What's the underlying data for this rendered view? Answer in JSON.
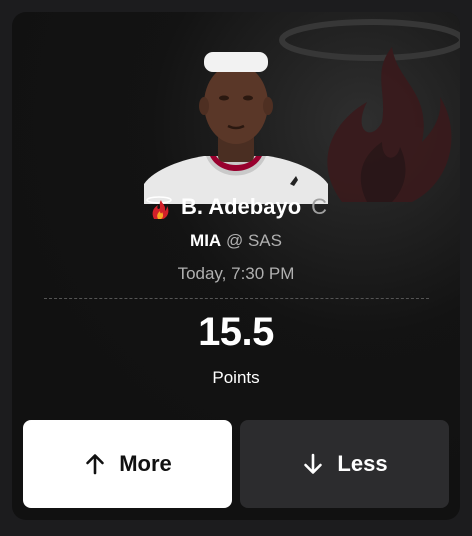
{
  "player": {
    "name": "B. Adebayo",
    "position": "C",
    "team": "MIA",
    "matchup_separator": "@",
    "opponent": "SAS",
    "game_time": "Today, 7:30 PM",
    "team_icon": "miami-heat-logo-icon",
    "photo": "player-headshot"
  },
  "prop": {
    "line": "15.5",
    "stat": "Points"
  },
  "actions": {
    "more_label": "More",
    "less_label": "Less",
    "more_icon": "arrow-up-icon",
    "less_icon": "arrow-down-icon"
  },
  "colors": {
    "card_background": "#111111",
    "page_background": "#1c1c1e",
    "more_button": "#ffffff",
    "less_button": "#2c2c2e",
    "heat_red": "#98002e"
  }
}
